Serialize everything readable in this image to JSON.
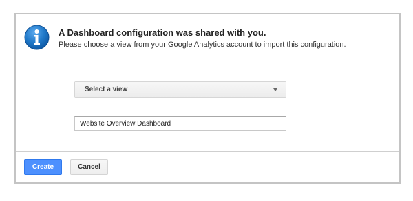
{
  "dialog": {
    "title": "A Dashboard configuration was shared with you.",
    "subtitle": "Please choose a view from your Google Analytics account to import this configuration.",
    "icon": "info-icon"
  },
  "form": {
    "view_select": {
      "selected": "Select a view"
    },
    "dashboard_name": {
      "value": "Website Overview Dashboard"
    }
  },
  "actions": {
    "create_label": "Create",
    "cancel_label": "Cancel"
  },
  "colors": {
    "primary_button": "#4d90fe",
    "info_icon": "#1a73c8",
    "border": "#c4c4c4"
  }
}
